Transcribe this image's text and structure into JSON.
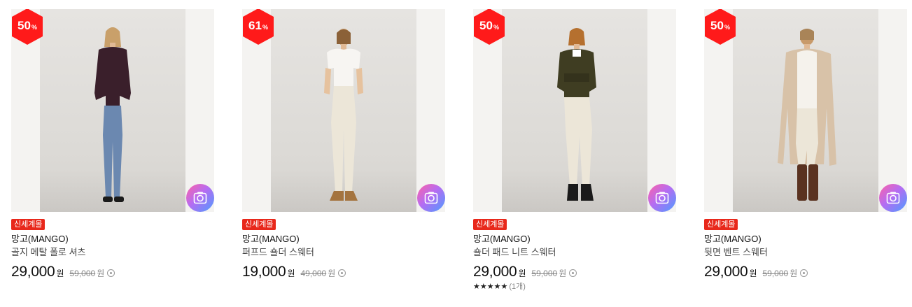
{
  "products": [
    {
      "discount": "50",
      "pct": "%",
      "tag": "신세계몰",
      "brand": "망고(MANGO)",
      "name": "골지 메탈 폴로 셔츠",
      "price": "29,000",
      "won": "원",
      "original": "59,000",
      "original_won": "원",
      "icon": "camera-icon",
      "colors": {
        "top": "#3a1f2b",
        "bottom": "#6b88b0",
        "shoe": "#1a1a1a"
      }
    },
    {
      "discount": "61",
      "pct": "%",
      "tag": "신세계몰",
      "brand": "망고(MANGO)",
      "name": "퍼프드 숄더 스웨터",
      "price": "19,000",
      "won": "원",
      "original": "49,000",
      "original_won": "원",
      "icon": "camera-icon",
      "colors": {
        "top": "#f7f5f2",
        "bottom": "#ece6d8",
        "shoe": "#a4743f"
      }
    },
    {
      "discount": "50",
      "pct": "%",
      "tag": "신세계몰",
      "brand": "망고(MANGO)",
      "name": "숄더 패드 니트 스웨터",
      "price": "29,000",
      "won": "원",
      "original": "59,000",
      "original_won": "원",
      "icon": "camera-icon",
      "rating_stars": "★★★★★",
      "rating_count": "(1개)",
      "rating": 5,
      "colors": {
        "top": "#3f3d22",
        "bottom": "#ece6d8",
        "shoe": "#1a1a1a"
      }
    },
    {
      "discount": "50",
      "pct": "%",
      "tag": "신세계몰",
      "brand": "망고(MANGO)",
      "name": "뒷면 벤트 스웨터",
      "price": "29,000",
      "won": "원",
      "original": "59,000",
      "original_won": "원",
      "icon": "camera-icon",
      "colors": {
        "top": "#f5f2ec",
        "bottom": "#ece6d8",
        "shoe": "#5a3220",
        "coat": "#d8c2a8"
      }
    }
  ],
  "accent": "#e8281b"
}
